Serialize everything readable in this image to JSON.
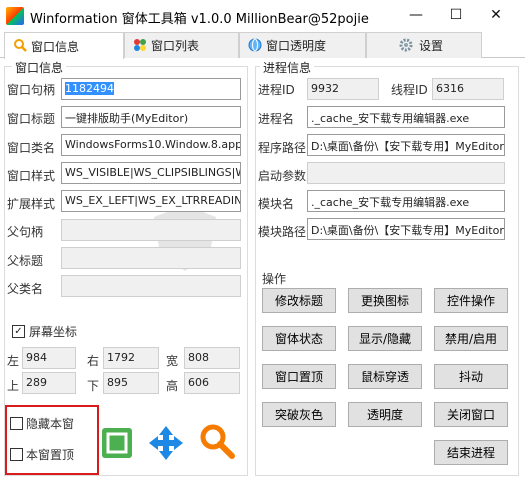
{
  "window": {
    "title": "Winformation 窗体工具箱 v1.0.0  MillionBear@52pojie",
    "min_glyph": "—",
    "max_glyph": "☐",
    "close_glyph": "✕"
  },
  "tabs": [
    {
      "label": "窗口信息",
      "icon": "search-icon",
      "active": true
    },
    {
      "label": "窗口列表",
      "icon": "palette-icon",
      "active": false
    },
    {
      "label": "窗口透明度",
      "icon": "globe-icon",
      "active": false
    },
    {
      "label": "设置",
      "icon": "gear-icon",
      "active": false
    }
  ],
  "window_info": {
    "group_title": "窗口信息",
    "handle_label": "窗口句柄",
    "handle_value": "1182494",
    "title_label": "窗口标题",
    "title_value": "一键排版助手(MyEditor)",
    "class_label": "窗口类名",
    "class_value": "WindowsForms10.Window.8.app.0.:",
    "style_label": "窗口样式",
    "style_value": "WS_VISIBLE|WS_CLIPSIBLINGS|WS_",
    "exstyle_label": "扩展样式",
    "exstyle_value": "WS_EX_LEFT|WS_EX_LTRREADING|",
    "parent_handle_label": "父句柄",
    "parent_handle_value": "",
    "parent_title_label": "父标题",
    "parent_title_value": "",
    "parent_class_label": "父类名",
    "parent_class_value": ""
  },
  "screen_coords": {
    "checkbox_label": "屏幕坐标",
    "checked": true,
    "left_label": "左",
    "left_value": "984",
    "right_label": "右",
    "right_value": "1792",
    "width_label": "宽",
    "width_value": "808",
    "top_label": "上",
    "top_value": "289",
    "bottom_label": "下",
    "bottom_value": "895",
    "height_label": "高",
    "height_value": "606"
  },
  "bottom_left": {
    "hide_self_label": "隐藏本窗",
    "top_most_label": "本窗置顶",
    "finder_icon": "window-finder-icon",
    "move_icon": "move-arrows-icon",
    "search_icon": "magnifier-icon"
  },
  "process_info": {
    "group_title": "进程信息",
    "pid_label": "进程ID",
    "pid_value": "9932",
    "tid_label": "线程ID",
    "tid_value": "6316",
    "name_label": "进程名",
    "name_value": "._cache_安下载专用编辑器.exe",
    "path_label": "程序路径",
    "path_value": "D:\\桌面\\备份\\【安下载专用】MyEditor",
    "args_label": "启动参数",
    "args_value": "",
    "module_label": "模块名",
    "module_value": "._cache_安下载专用编辑器.exe",
    "module_path_label": "模块路径",
    "module_path_value": "D:\\桌面\\备份\\【安下载专用】MyEditor"
  },
  "operations": {
    "group_title": "操作",
    "buttons": [
      "修改标题",
      "更换图标",
      "控件操作",
      "窗体状态",
      "显示/隐藏",
      "禁用/启用",
      "窗口置顶",
      "鼠标穿透",
      "抖动",
      "突破灰色",
      "透明度",
      "关闭窗口",
      "结束进程"
    ]
  },
  "watermark_text": "安下载"
}
